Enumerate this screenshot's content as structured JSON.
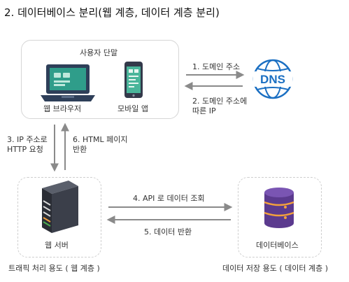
{
  "title": "2. 데이터베이스 분리(웹 계층, 데이터 계층 분리)",
  "user_terminal": {
    "label": "사용자 단말",
    "web_browser": "웹 브라우저",
    "mobile_app": "모바일 앱"
  },
  "dns": {
    "label": "DNS",
    "req_label": "1. 도메인 주소",
    "resp_label_line1": "2. 도메인 주소에",
    "resp_label_line2": "따른 IP"
  },
  "http": {
    "req_line1": "3. IP 주소로",
    "req_line2": "HTTP 요청",
    "resp_line1": "6. HTML 페이지",
    "resp_line2": "반환"
  },
  "web_server": {
    "label": "웹 서버",
    "caption": "트래픽 처리 용도 ( 웹 계층 )"
  },
  "database": {
    "label": "데이터베이스",
    "caption": "데이터 저장 용도 ( 데이터 계층 )",
    "query_label": "4. API 로 데이터 조회",
    "return_label": "5. 데이터 반환"
  },
  "colors": {
    "arrow": "#8a8a8a",
    "dns_blue": "#1b6fc2",
    "laptop_dark": "#2e3f59",
    "laptop_screen": "#2f9d8a",
    "phone_dark": "#33394a",
    "server_dark": "#3b3f4a",
    "db_purple": "#5b3a8e",
    "db_orange": "#f2a03d"
  }
}
